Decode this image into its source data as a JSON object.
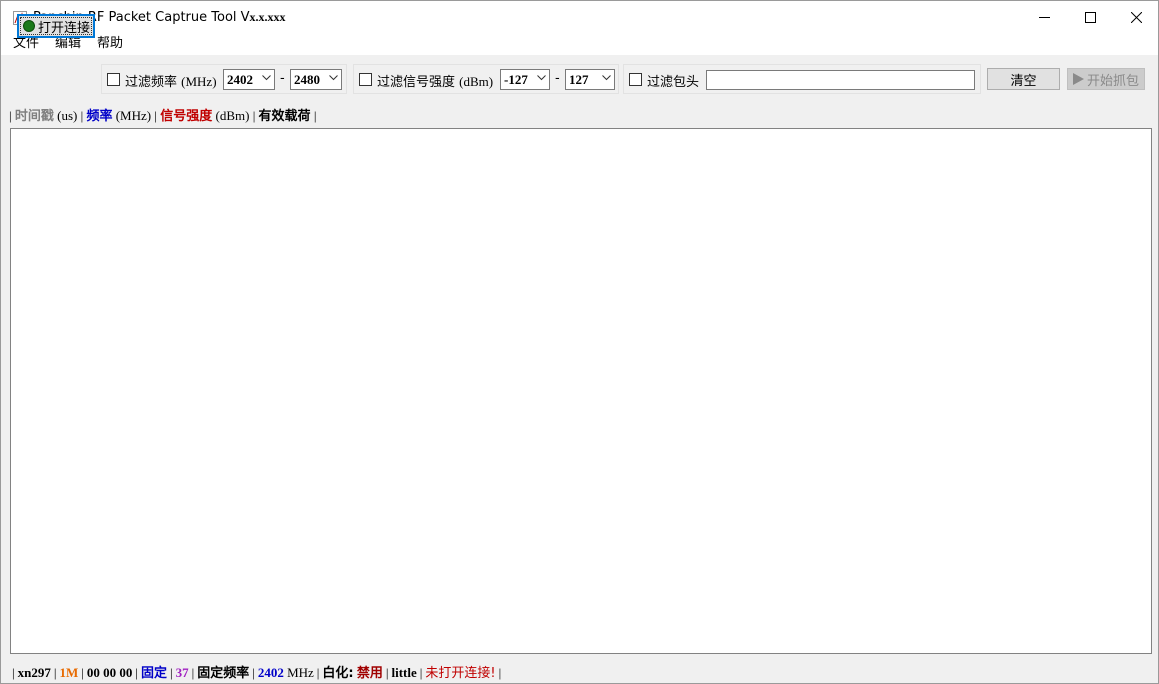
{
  "window": {
    "title_prefix": "Panchip RF Packet Captrue Tool V",
    "title_version": "x.x.xxx",
    "icon": "app-icon"
  },
  "menu": [
    "文件",
    "编辑",
    "帮助"
  ],
  "toolbar": {
    "connect_label": "打开连接",
    "filter_freq_label": "过滤频率",
    "filter_freq_unit": "(MHz)",
    "freq_min": "2402",
    "freq_max": "2480",
    "range_dash": "-",
    "filter_rssi_label": "过滤信号强度",
    "filter_rssi_unit": "(dBm)",
    "rssi_min": "-127",
    "rssi_max": "127",
    "filter_header_label": "过滤包头",
    "filter_header_value": "",
    "clear_label": "清空",
    "start_capture_label": "开始抓包",
    "start_capture_icon": "play-icon"
  },
  "legend": {
    "sep": "|",
    "timestamp": "时间戳",
    "timestamp_unit": "(us)",
    "freq": "频率",
    "freq_unit": "(MHz)",
    "rssi": "信号强度",
    "rssi_unit": "(dBm)",
    "payload": "有效载荷"
  },
  "status": {
    "chip": "xn297",
    "rate": "1M",
    "address": "00 00 00",
    "mode": "固定",
    "channel": "37",
    "freq_mode": "固定频率",
    "freq_value": "2402",
    "freq_unit": "MHz",
    "whitening_label": "白化:",
    "whitening_value": "禁用",
    "endian": "little",
    "connection": "未打开连接!"
  },
  "colors": {
    "accent": "#0078d7",
    "led": "#1a7a1a",
    "blue": "#0000c8",
    "red": "#c00000",
    "orange": "#e86a00",
    "purple": "#a020c0"
  }
}
